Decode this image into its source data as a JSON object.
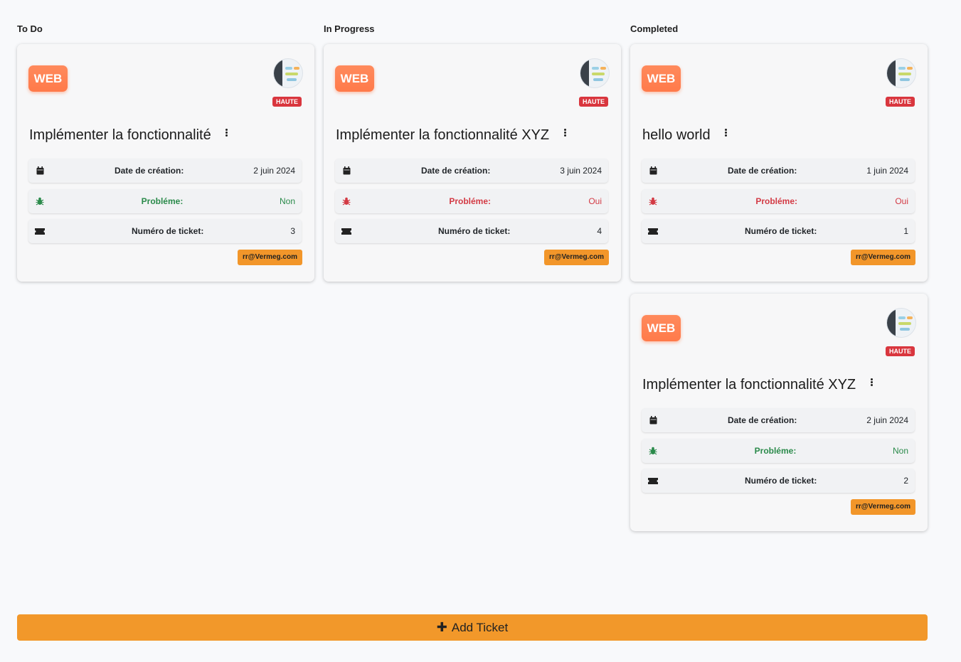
{
  "board": {
    "add_button_label": "Add Ticket",
    "columns": [
      {
        "title": "To Do",
        "cards": [
          {
            "category": "WEB",
            "priority": "HAUTE",
            "title": "Implémenter la fonctionnalité",
            "date_label": "Date de création:",
            "date_value": "2 juin 2024",
            "problem_label": "Probléme:",
            "problem_value": "Non",
            "ticket_label": "Numéro de ticket:",
            "ticket_value": "3",
            "email": "rr@Vermeg.com"
          }
        ]
      },
      {
        "title": "In Progress",
        "cards": [
          {
            "category": "WEB",
            "priority": "HAUTE",
            "title": "Implémenter la fonctionnalité XYZ",
            "date_label": "Date de création:",
            "date_value": "3 juin 2024",
            "problem_label": "Probléme:",
            "problem_value": "Oui",
            "ticket_label": "Numéro de ticket:",
            "ticket_value": "4",
            "email": "rr@Vermeg.com"
          }
        ]
      },
      {
        "title": "Completed",
        "cards": [
          {
            "category": "WEB",
            "priority": "HAUTE",
            "title": "hello world",
            "date_label": "Date de création:",
            "date_value": "1 juin 2024",
            "problem_label": "Probléme:",
            "problem_value": "Oui",
            "ticket_label": "Numéro de ticket:",
            "ticket_value": "1",
            "email": "rr@Vermeg.com"
          },
          {
            "category": "WEB",
            "priority": "HAUTE",
            "title": "Implémenter la fonctionnalité XYZ",
            "date_label": "Date de création:",
            "date_value": "2 juin 2024",
            "problem_label": "Probléme:",
            "problem_value": "Non",
            "ticket_label": "Numéro de ticket:",
            "ticket_value": "2",
            "email": "rr@Vermeg.com"
          }
        ]
      }
    ]
  },
  "icons": {
    "date": "calendar-icon",
    "problem": "bug-icon",
    "ticket": "ticket-icon",
    "add": "plus-icon",
    "menu": "kebab-menu-icon"
  },
  "colors": {
    "category_badge": "#ff7a4a",
    "priority_badge": "#d9363e",
    "problem_no": "#2a8a4a",
    "problem_yes": "#d33a44",
    "accent": "#f2982a"
  }
}
